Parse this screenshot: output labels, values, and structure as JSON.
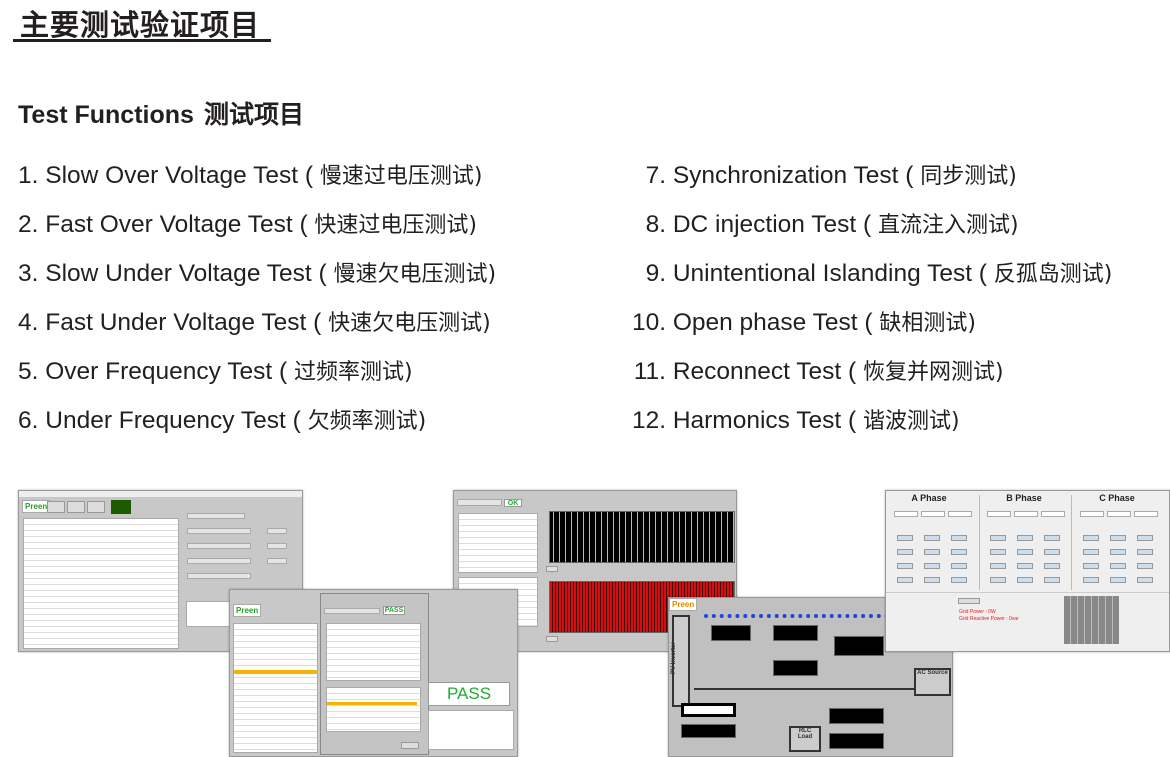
{
  "heading": "主要测试验证项目",
  "subheading": {
    "en": "Test Functions",
    "cn": "测试项目"
  },
  "tests_left": [
    {
      "num": "1.",
      "en": "Slow Over Voltage Test (",
      "cn": "慢速过电压测试)"
    },
    {
      "num": "2.",
      "en": "Fast Over Voltage Test (",
      "cn": "快速过电压测试)"
    },
    {
      "num": "3.",
      "en": "Slow Under Voltage Test (",
      "cn": "慢速欠电压测试)"
    },
    {
      "num": "4.",
      "en": "Fast Under Voltage Test (",
      "cn": "快速欠电压测试)"
    },
    {
      "num": "5.",
      "en": "Over Frequency Test (",
      "cn": "过频率测试)"
    },
    {
      "num": "6.",
      "en": "Under Frequency Test (",
      "cn": "欠频率测试)"
    }
  ],
  "tests_right": [
    {
      "num": "7.",
      "en": "Synchronization Test (",
      "cn": "同步测试)"
    },
    {
      "num": "8.",
      "en": "DC injection Test (",
      "cn": "直流注入测试)"
    },
    {
      "num": "9.",
      "en": "Unintentional Islanding Test (",
      "cn": "反孤岛测试)"
    },
    {
      "num": "10.",
      "en": "Open phase Test (",
      "cn": "缺相测试)"
    },
    {
      "num": "11.",
      "en": "Reconnect Test (",
      "cn": "恢复并网测试)"
    },
    {
      "num": "12.",
      "en": "Harmonics Test (",
      "cn": "谐波测试)"
    }
  ],
  "screenshots": {
    "logo": "Preen",
    "pass": "PASS",
    "ok": "OK",
    "phases": [
      "A Phase",
      "B Phase",
      "C Phase"
    ],
    "grid_power": "Grid Power : 0W",
    "grid_reactive": "Grid Reactive Power : 0var",
    "pv_inverter": "PV Inverter",
    "ac_source": "AC Source",
    "rlc_load": "RLC Load"
  },
  "colors": {
    "pass": "#22aa33",
    "highlight": "#f5b400",
    "waveform": "#d01010"
  }
}
